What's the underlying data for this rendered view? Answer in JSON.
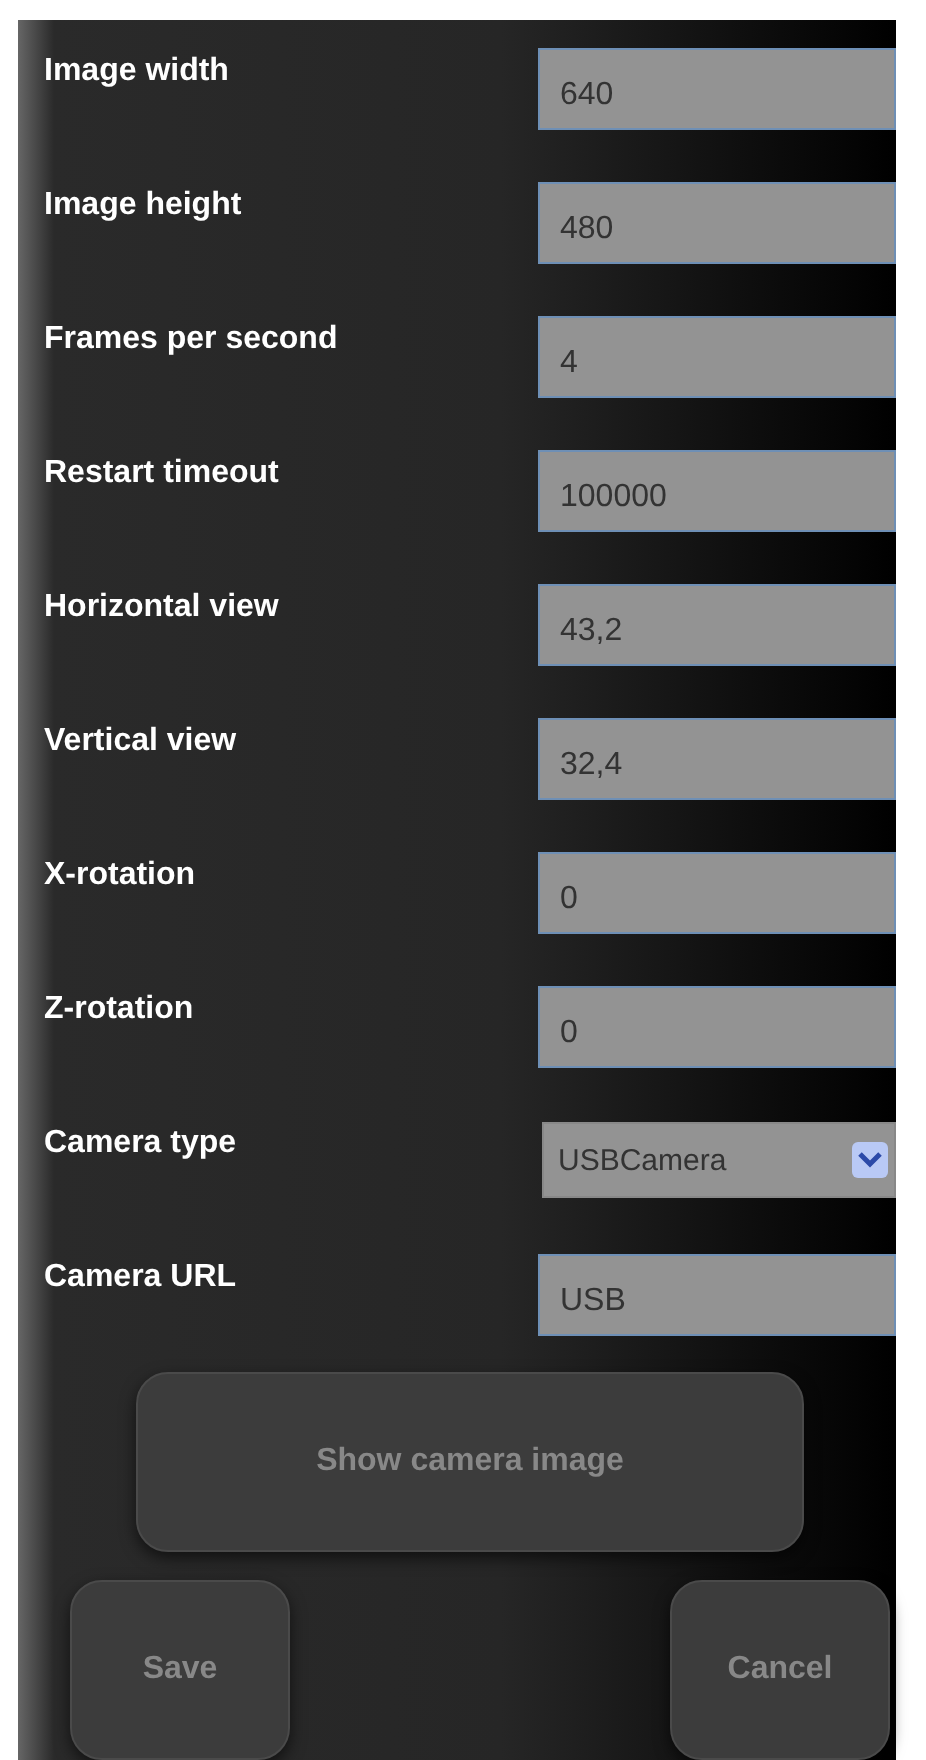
{
  "fields": [
    {
      "kind": "text",
      "label": "Image width",
      "value": "640"
    },
    {
      "kind": "text",
      "label": "Image height",
      "value": "480"
    },
    {
      "kind": "text",
      "label": "Frames per second",
      "value": "4"
    },
    {
      "kind": "text",
      "label": "Restart timeout",
      "value": "100000"
    },
    {
      "kind": "text",
      "label": "Horizontal view",
      "value": "43,2"
    },
    {
      "kind": "text",
      "label": "Vertical view",
      "value": "32,4"
    },
    {
      "kind": "text",
      "label": "X-rotation",
      "value": "0"
    },
    {
      "kind": "text",
      "label": "Z-rotation",
      "value": "0"
    },
    {
      "kind": "select",
      "label": "Camera type",
      "value": "USBCamera"
    },
    {
      "kind": "text",
      "label": "Camera URL",
      "value": "USB"
    }
  ],
  "show_button": "Show camera image",
  "save_button": "Save",
  "cancel_button": "Cancel"
}
